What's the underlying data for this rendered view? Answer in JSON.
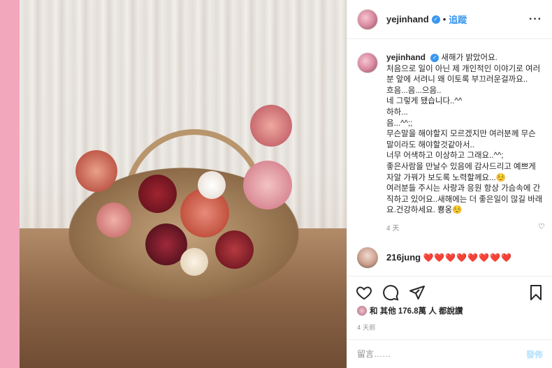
{
  "post": {
    "username": "yejinhand",
    "follow_label": "追蹤",
    "dot": "•",
    "more": "···"
  },
  "caption": {
    "username": "yejinhand",
    "lines": [
      "새해가 밝았어요.",
      "처음으로 일이 아닌 제 개인적인 이야기로 여러분 앞에 서려니 왜 이토록 부끄러운걸까요..",
      "흐음...음...으음..",
      "네 그렇게 됐습니다..^^",
      "하하...",
      "음...^^;;",
      "무슨말을 해야할지 모르겠지만 여러분께 무슨 말이라도 해야할것같아서..",
      "너무 어색하고 이상하고 그래요..^^;",
      "좋은사람을 만날수 있음에 감사드리고 예쁘게 자알 가꿔가 보도록 노력할께요...☺️",
      "여러분들 주시는 사랑과 응원 항상 가슴속에 간직하고 있어요..새해에는 더 좋은일이 많길 바래요.건강하세요. 뿅옹☺️"
    ],
    "time": "4 天"
  },
  "comment": {
    "username": "216jung",
    "text": "❤️❤️❤️❤️❤️❤️❤️❤️"
  },
  "icons": {
    "like": "heart-icon",
    "comment": "comment-icon",
    "share": "share-icon",
    "save": "bookmark-icon"
  },
  "likes_text": "和 其他 176.8萬 人 都說讚",
  "post_time": "4 天前",
  "add_comment": {
    "placeholder": "留言……",
    "post_label": "發佈"
  },
  "colors": {
    "background": "#f2a7bc",
    "accent": "#3897f0",
    "heart": "#e0245e"
  }
}
